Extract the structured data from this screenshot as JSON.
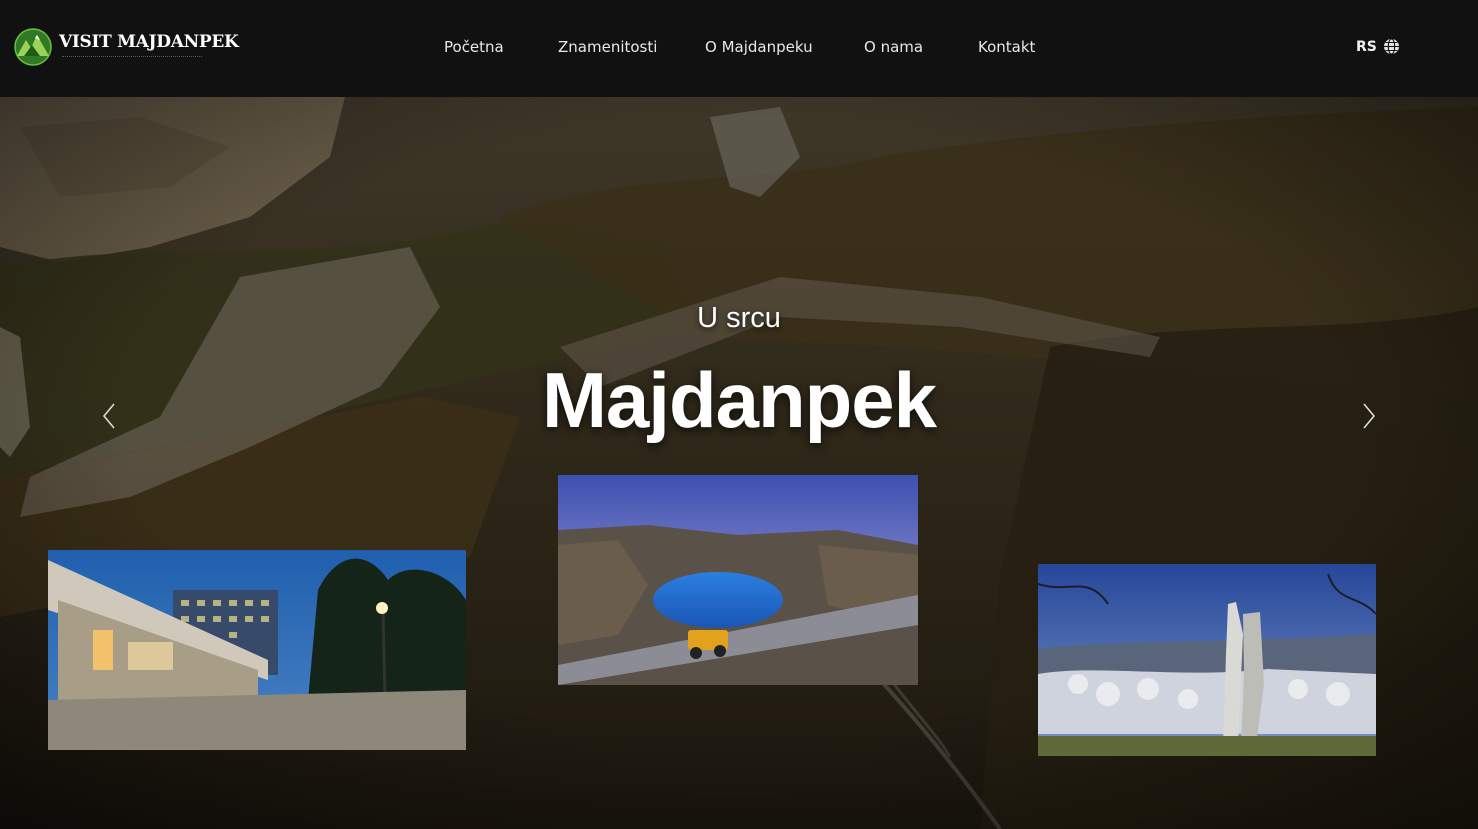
{
  "header": {
    "logo_text": "VISIT MAJDANPEK",
    "nav": [
      {
        "label": "Početna"
      },
      {
        "label": "Znamenitosti"
      },
      {
        "label": "O Majdanpeku"
      },
      {
        "label": "O nama"
      },
      {
        "label": "Kontakt"
      }
    ],
    "language": "RS"
  },
  "hero": {
    "kicker": "U srcu",
    "title": "Majdanpek"
  },
  "colors": {
    "header_bg": "#111111",
    "logo_green": "#3f8f2a",
    "text": "#ffffff"
  },
  "icons": {
    "language": "globe-icon",
    "prev": "chevron-left-icon",
    "next": "chevron-right-icon"
  }
}
